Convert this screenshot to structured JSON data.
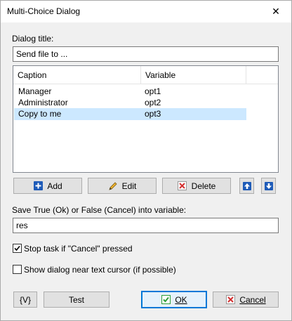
{
  "window": {
    "title": "Multi-Choice Dialog",
    "close_glyph": "✕"
  },
  "dialog_title": {
    "label": "Dialog title:",
    "value": "Send file to ..."
  },
  "list": {
    "columns": [
      "Caption",
      "Variable"
    ],
    "rows": [
      {
        "caption": "Manager",
        "variable": "opt1"
      },
      {
        "caption": "Administrator",
        "variable": "opt2"
      },
      {
        "caption": "Copy to me",
        "variable": "opt3",
        "selected": true
      }
    ]
  },
  "list_buttons": {
    "add": "Add",
    "edit": "Edit",
    "delete": "Delete"
  },
  "variable": {
    "label": "Save True (Ok) or False (Cancel)  into variable:",
    "value": "res"
  },
  "options": {
    "stop_task": {
      "label": "Stop task if \"Cancel\" pressed",
      "checked": true
    },
    "near_cursor": {
      "label": "Show dialog near text cursor (if possible)",
      "checked": false
    }
  },
  "footer": {
    "vars_label": "{V}",
    "test_label": "Test",
    "ok_label": "OK",
    "cancel_label": "Cancel"
  },
  "colors": {
    "accent": "#0078d7",
    "selection": "#cce8ff",
    "add_blue": "#1e5bb8",
    "delete_red": "#d32f2f",
    "ok_green": "#2e9e3a"
  }
}
